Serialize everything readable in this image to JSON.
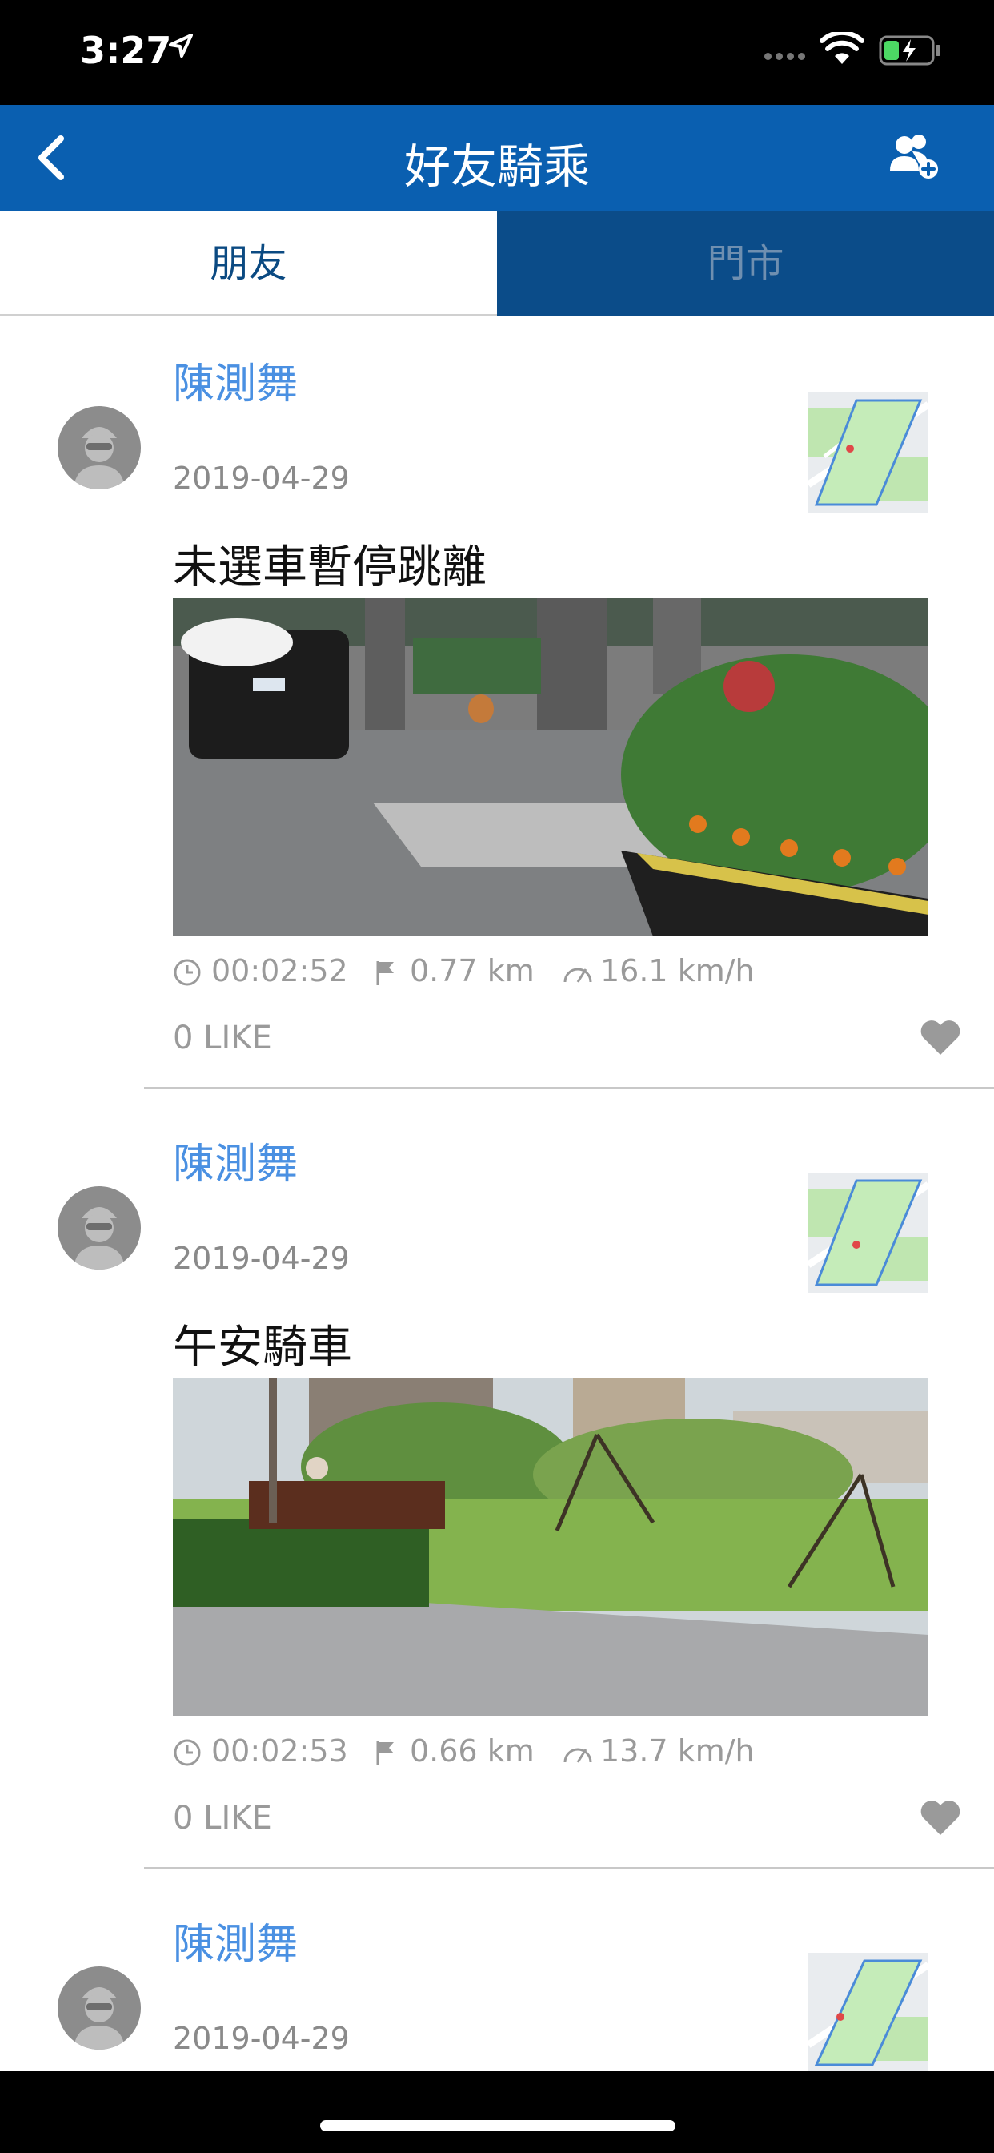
{
  "status_bar": {
    "time": "3:27"
  },
  "nav": {
    "title": "好友騎乘"
  },
  "tabs": [
    {
      "label": "朋友"
    },
    {
      "label": "門市"
    }
  ],
  "posts": [
    {
      "user": "陳測舞",
      "date": "2019-04-29",
      "title": "未選車暫停跳離",
      "duration": "00:02:52",
      "distance": "0.77 km",
      "speed": "16.1 km/h",
      "likes": "0 LIKE"
    },
    {
      "user": "陳測舞",
      "date": "2019-04-29",
      "title": "午安騎車",
      "duration": "00:02:53",
      "distance": "0.66 km",
      "speed": "13.7 km/h",
      "likes": "0 LIKE"
    },
    {
      "user": "陳測舞",
      "date": "2019-04-29"
    }
  ],
  "icons": {
    "back": "chevron-left-icon",
    "add_friend": "add-friend-icon",
    "clock": "clock-icon",
    "flag": "flag-icon",
    "speed": "speedometer-icon",
    "like": "heart-icon"
  },
  "colors": {
    "nav_blue": "#0a5fb0",
    "tab_inactive_bg": "#0b4c89",
    "username_blue": "#4a90e2"
  }
}
